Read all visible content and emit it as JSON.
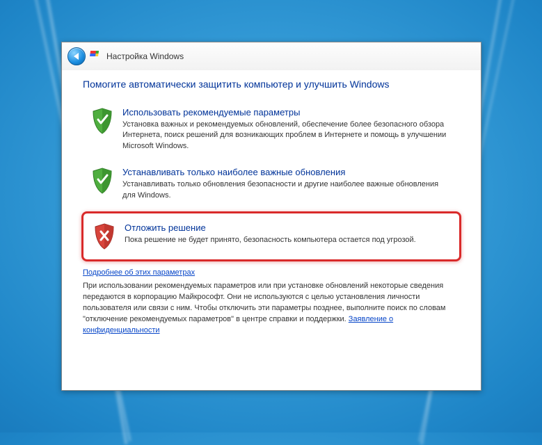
{
  "header": {
    "title": "Настройка Windows"
  },
  "heading": "Помогите автоматически защитить компьютер и улучшить Windows",
  "options": [
    {
      "title": "Использовать рекомендуемые параметры",
      "desc": "Установка важных и рекомендуемых обновлений, обеспечение более безопасного обзора Интернета, поиск решений для возникающих проблем в Интернете и помощь в улучшении Microsoft Windows."
    },
    {
      "title": "Устанавливать только наиболее важные обновления",
      "desc": "Устанавливать только обновления безопасности и другие наиболее важные обновления для Windows."
    },
    {
      "title": "Отложить решение",
      "desc": "Пока решение не будет принято, безопасность компьютера остается под угрозой."
    }
  ],
  "more_link": "Подробнее об этих параметрах",
  "footnote_part1": "При использовании рекомендуемых параметров или при установке обновлений некоторые сведения передаются в корпорацию Майкрософт. Они не используются с целью установления личности пользователя или связи с ним. Чтобы отключить эти параметры позднее, выполните поиск по словам \"отключение рекомендуемых параметров\" в центре справки и поддержки. ",
  "privacy_link": "Заявление о конфиденциальности"
}
